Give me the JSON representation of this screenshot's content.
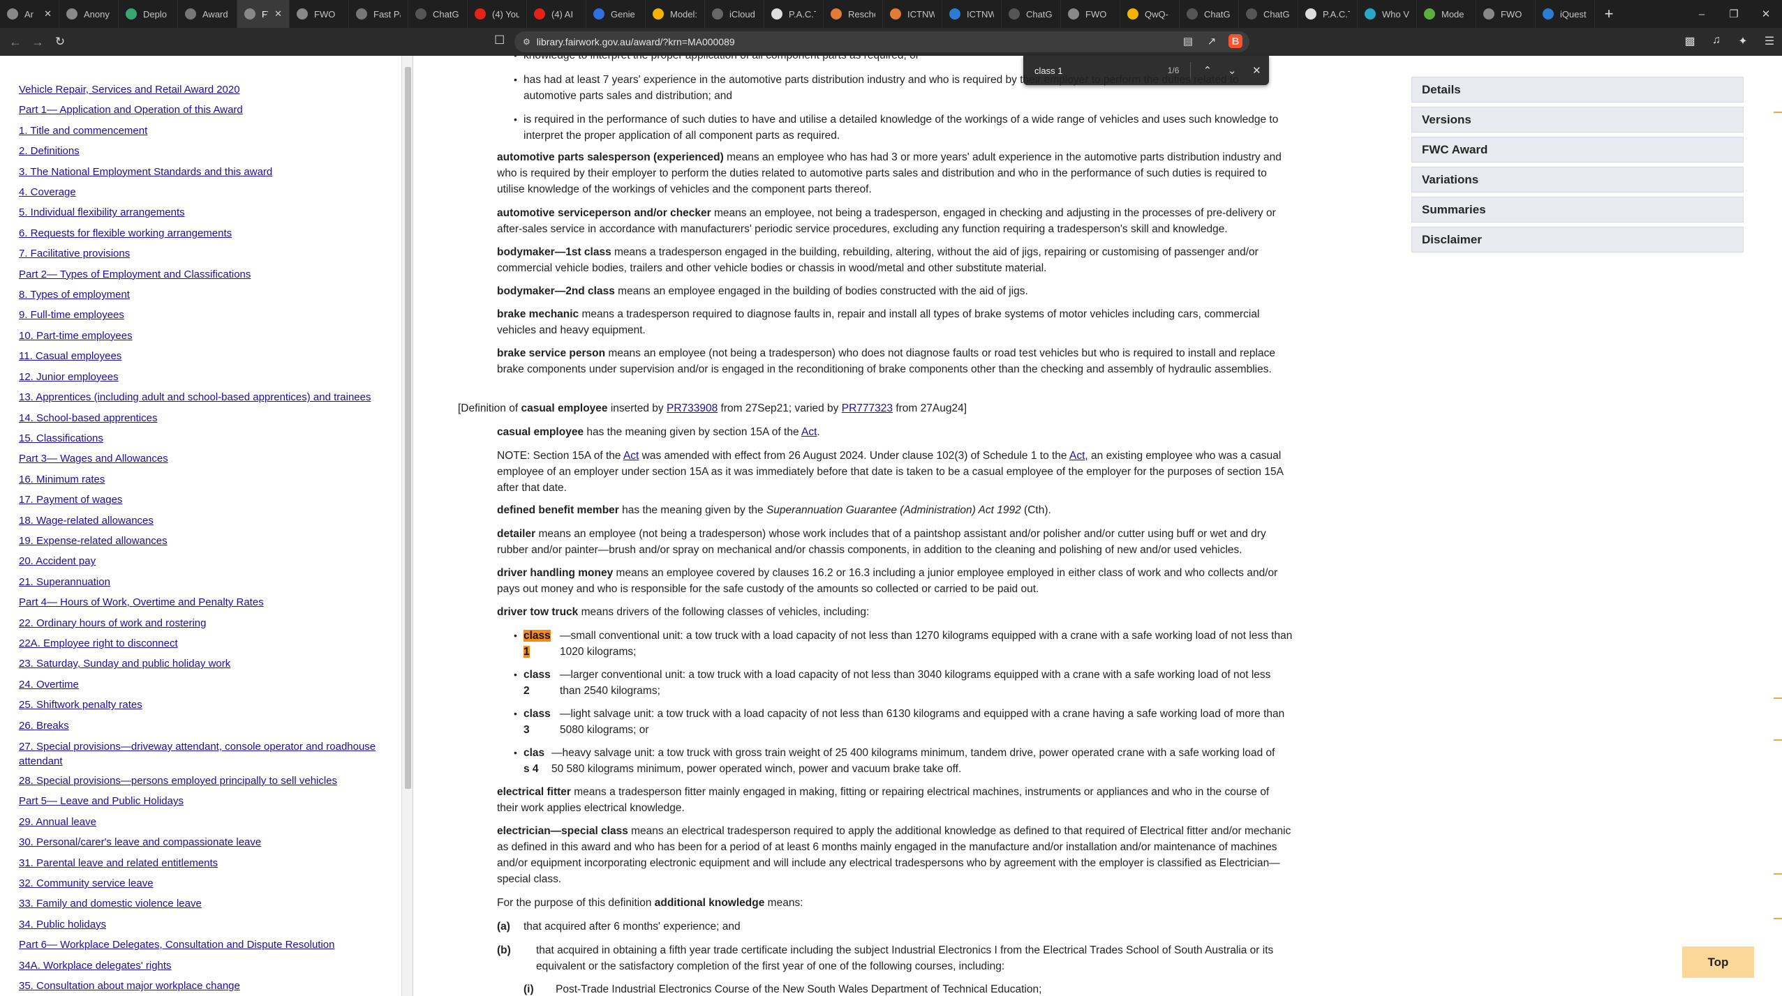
{
  "browser": {
    "tabs": [
      {
        "label": "Ar",
        "icon": "github-icon",
        "color": "#888888",
        "active": false,
        "closable": true
      },
      {
        "label": "Anony",
        "icon": "github-icon",
        "color": "#888888",
        "active": false
      },
      {
        "label": "Deplo",
        "icon": "deploy-icon",
        "color": "#3aa675",
        "active": false
      },
      {
        "label": "Award",
        "icon": "compass-icon",
        "color": "#777777",
        "active": false
      },
      {
        "label": "FV",
        "icon": "fwc-icon",
        "color": "#888888",
        "active": true,
        "closable": true
      },
      {
        "label": "FWO",
        "icon": "fwc-icon",
        "color": "#888888",
        "active": false
      },
      {
        "label": "Fast Pa",
        "icon": "compass-icon",
        "color": "#777777",
        "active": false
      },
      {
        "label": "ChatG",
        "icon": "openai-icon",
        "color": "#555555",
        "active": false
      },
      {
        "label": "(4) You",
        "icon": "youtube-icon",
        "color": "#e62117",
        "active": false
      },
      {
        "label": "(4) AI",
        "icon": "youtube-icon",
        "color": "#e62117",
        "active": false
      },
      {
        "label": "Genie",
        "icon": "genie-icon",
        "color": "#2f6fe0",
        "active": false
      },
      {
        "label": "Model:",
        "icon": "huggingface-icon",
        "color": "#f2b400",
        "active": false
      },
      {
        "label": "iCloud",
        "icon": "apple-icon",
        "color": "#666666",
        "active": false
      },
      {
        "label": "P.A.C.T",
        "icon": "document-icon",
        "color": "#dddddd",
        "active": false
      },
      {
        "label": "Resche",
        "icon": "sparkle-icon",
        "color": "#e07b39",
        "active": false
      },
      {
        "label": "ICTNW",
        "icon": "sparkle-icon",
        "color": "#e07b39",
        "active": false
      },
      {
        "label": "ICTNW",
        "icon": "cloud-icon",
        "color": "#2b7cd3",
        "active": false
      },
      {
        "label": "ChatG",
        "icon": "openai-icon",
        "color": "#555555",
        "active": false
      },
      {
        "label": "FWO",
        "icon": "fwc-icon",
        "color": "#888888",
        "active": false
      },
      {
        "label": "QwQ-",
        "icon": "huggingface-icon",
        "color": "#f2b400",
        "active": false
      },
      {
        "label": "ChatG",
        "icon": "openai-icon",
        "color": "#555555",
        "active": false
      },
      {
        "label": "ChatG",
        "icon": "openai-icon",
        "color": "#555555",
        "active": false
      },
      {
        "label": "P.A.C.T",
        "icon": "document-icon",
        "color": "#dddddd",
        "active": false
      },
      {
        "label": "Who V",
        "icon": "circle-icon",
        "color": "#2aa6c8",
        "active": false
      },
      {
        "label": "Mode",
        "icon": "model-icon",
        "color": "#5cae3e",
        "active": false
      },
      {
        "label": "FWO",
        "icon": "fwc-icon",
        "color": "#888888",
        "active": false
      },
      {
        "label": "iQuest",
        "icon": "iq-icon",
        "color": "#2b7cd3",
        "active": false
      }
    ],
    "url": "library.fairwork.gov.au/award/?krn=MA000089",
    "find": {
      "query": "class 1",
      "count": "1/6"
    }
  },
  "toc": [
    "Vehicle Repair, Services and Retail Award 2020",
    "Part 1— Application and Operation of this Award",
    "1. Title and commencement",
    "2. Definitions",
    "3. The National Employment Standards and this award",
    "4. Coverage",
    "5. Individual flexibility arrangements",
    "6. Requests for flexible working arrangements",
    "7. Facilitative provisions",
    "Part 2— Types of Employment and Classifications",
    "8. Types of employment",
    "9. Full-time employees",
    "10. Part-time employees",
    "11. Casual employees",
    "12. Junior employees",
    "13. Apprentices (including adult and school-based apprentices) and trainees",
    "14. School-based apprentices",
    "15. Classifications",
    "Part 3— Wages and Allowances",
    "16. Minimum rates",
    "17. Payment of wages",
    "18. Wage-related allowances",
    "19. Expense-related allowances",
    "20. Accident pay",
    "21. Superannuation",
    "Part 4— Hours of Work, Overtime and Penalty Rates",
    "22. Ordinary hours of work and rostering",
    "22A. Employee right to disconnect",
    "23. Saturday, Sunday and public holiday work",
    "24. Overtime",
    "25. Shiftwork penalty rates",
    "26. Breaks",
    "27. Special provisions—driveway attendant, console operator and roadhouse attendant",
    "28. Special provisions—persons employed principally to sell vehicles",
    "Part 5— Leave and Public Holidays",
    "29. Annual leave",
    "30. Personal/carer's leave and compassionate leave",
    "31. Parental leave and related entitlements",
    "32. Community service leave",
    "33. Family and domestic violence leave",
    "34. Public holidays",
    "Part 6— Workplace Delegates, Consultation and Dispute Resolution",
    "34A. Workplace delegates' rights",
    "35. Consultation about major workplace change"
  ],
  "doc": {
    "bullets_top": [
      "knowledge to interpret the proper application of all component parts as required; or",
      "has had at least 7 years' experience in the automotive parts distribution industry and who is required by their employer to perform the duties related to automotive parts sales and distribution; and",
      "is required in the performance of such duties to have and utilise a detailed knowledge of the workings of a wide range of vehicles and uses such knowledge to interpret the proper application of all component parts as required."
    ],
    "defs": {
      "apse_term": "automotive parts salesperson (experienced)",
      "apse_text": " means an employee who has had 3 or more years' adult experience in the automotive parts distribution industry and who is required by their employer to perform the duties related to automotive parts sales and distribution and who in the performance of such duties is required to utilise knowledge of the workings of vehicles and the component parts thereof.",
      "asc_term": "automotive serviceperson and/or checker",
      "asc_text": " means an employee, not being a tradesperson, engaged in checking and adjusting in the processes of pre-delivery or after-sales service in accordance with manufacturers' periodic service procedures, excluding any function requiring a tradesperson's skill and knowledge.",
      "bm1_term": "bodymaker—1st class",
      "bm1_text": " means a tradesperson engaged in the building, rebuilding, altering, without the aid of jigs, repairing or customising of passenger and/or commercial vehicle bodies, trailers and other vehicle bodies or chassis in wood/metal and other substitute material.",
      "bm2_term": "bodymaker—2nd class",
      "bm2_text": " means an employee engaged in the building of bodies constructed with the aid of jigs.",
      "bmech_term": "brake mechanic",
      "bmech_text": " means a tradesperson required to diagnose faults in, repair and install all types of brake systems of motor vehicles including cars, commercial vehicles and heavy equipment.",
      "bsp_term": "brake service person",
      "bsp_text": " means an employee (not being a tradesperson) who does not diagnose faults or road test vehicles but who is required to install and replace brake components under supervision and/or is engaged in the reconditioning of brake components other than the checking and assembly of hydraulic assemblies.",
      "casual_note_pre": "[Definition of ",
      "casual_note_term": "casual employee",
      "casual_note_mid1": " inserted by ",
      "casual_note_link1": "PR733908",
      "casual_note_mid2": " from 27Sep21; varied by ",
      "casual_note_link2": "PR777323",
      "casual_note_end": " from 27Aug24]",
      "ce_term": "casual employee",
      "ce_text1": " has the meaning given by section 15A of the ",
      "ce_act": "Act",
      "ce_text2": ".",
      "note_a": "NOTE: Section 15A of the ",
      "note_act1": "Act",
      "note_b": " was amended with effect from 26 August 2024. Under clause 102(3) of Schedule 1 to the ",
      "note_act2": "Act",
      "note_c": ", an existing employee who was a casual employee of an employer under section 15A as it was immediately before that date is taken to be a casual employee of the employer for the purposes of section 15A after that date.",
      "dbm_term": "defined benefit member",
      "dbm_text1": " has the meaning given by the ",
      "dbm_italic": "Superannuation Guarantee (Administration) Act 1992",
      "dbm_text2": " (Cth).",
      "det_term": "detailer",
      "det_text": " means an employee (not being a tradesperson) whose work includes that of a paintshop assistant and/or polisher and/or cutter using buff or wet and dry rubber and/or painter—brush and/or spray on mechanical and/or chassis components, in addition to the cleaning and polishing of new and/or used vehicles.",
      "dhm_term": "driver handling money",
      "dhm_text": " means an employee covered by clauses 16.2 or 16.3 including a junior employee employed in either class of work and who collects and/or pays out money and who is responsible for the safe custody of the amounts so collected or carried to be paid out.",
      "dtt_term": "driver tow truck",
      "dtt_text": " means drivers of the following classes of vehicles, including:",
      "ef_term": "electrical fitter",
      "ef_text": " means a tradesperson fitter mainly engaged in making, fitting or repairing electrical machines, instruments or appliances and who in the course of their work applies electrical knowledge.",
      "esc_term": "electrician—special class",
      "esc_text": " means an electrical tradesperson required to apply the additional knowledge as defined to that required of Electrical fitter and/or mechanic as defined in this award and who has been for a period of at least 6 months mainly engaged in the manufacture and/or installation and/or maintenance of machines and/or equipment incorporating electronic equipment and will include any electrical tradespersons who by agreement with the employer is classified as Electrician—special class.",
      "ak_pre": "For the purpose of this definition ",
      "ak_term": "additional knowledge",
      "ak_post": " means:",
      "a_label": "(a)",
      "a_text": "that acquired after 6 months' experience; and",
      "b_label": "(b)",
      "b_text": "that acquired in obtaining a fifth year trade certificate including the subject Industrial Electronics I from the Electrical Trades School of South Australia or its equivalent or the satisfactory completion of the first year of one of the following courses, including:",
      "i_label": "(i)",
      "i_text": "Post-Trade Industrial Electronics Course of the New South Wales Department of Technical Education;"
    },
    "tow_classes": [
      {
        "l1": "class",
        "l2": "1",
        "text": "—small conventional unit: a tow truck with a load capacity of not less than 1270 kilograms equipped with a crane with a safe working load of not less than 1020 kilograms;"
      },
      {
        "l1": "class",
        "l2": "2",
        "text": "—larger conventional unit: a tow truck with a load capacity of not less than 3040 kilograms equipped with a crane with a safe working load of not less than 2540 kilograms;"
      },
      {
        "l1": "class",
        "l2": "3",
        "text": "—light salvage unit: a tow truck with a load capacity of not less than 6130 kilograms and equipped with a crane having a safe working load of more than 5080 kilograms; or"
      },
      {
        "l1": "clas",
        "l2": "s 4",
        "text": "—heavy salvage unit: a tow truck with gross train weight of 25 400 kilograms minimum, tandem drive, power operated crane with a safe working load of 50 580 kilograms minimum, power operated winch, power and vacuum brake take off."
      }
    ]
  },
  "sidenav": [
    "Details",
    "Versions",
    "FWC Award",
    "Variations",
    "Summaries",
    "Disclaimer"
  ],
  "top_button": "Top",
  "colors": {
    "link": "#1a0dab",
    "highlight": "#f48a1c",
    "sidenav_bg": "#e9e9f0",
    "top_bg": "#fcd79a"
  }
}
